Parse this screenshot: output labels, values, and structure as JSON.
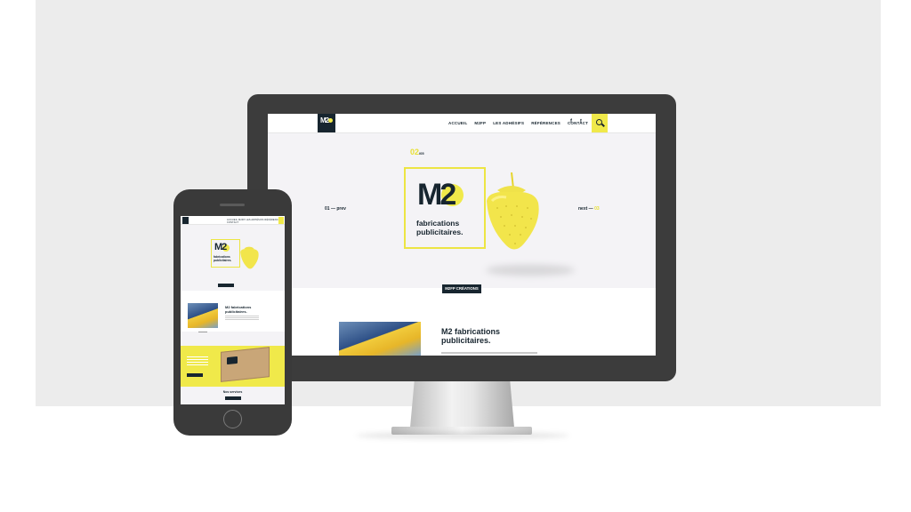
{
  "colors": {
    "accent": "#f0e94a",
    "navy": "#17252f",
    "light_bg": "#f4f3f6"
  },
  "desktop": {
    "nav": {
      "logo_text": "M2",
      "menu": [
        "ACCUEIL",
        "M2FP",
        "LES ADHÉSIFS",
        "RÉFÉRENCES",
        "CONTACT"
      ],
      "social": [
        "f",
        "t"
      ],
      "search_icon": "search-icon"
    },
    "hero": {
      "slide_current": "02",
      "slide_total": "/05",
      "prev_num": "01",
      "prev_label": "prev",
      "next_label": "next",
      "next_num": "03",
      "logo_text": "M2",
      "tagline_line1": "fabrications",
      "tagline_line2": "publicitaires."
    },
    "button": "M2FP CRÉATIONS",
    "section": {
      "title_line1": "M2 fabrications",
      "title_line2": "publicitaires."
    }
  },
  "phone": {
    "nav": {
      "menu": "ACCUEIL  M2FP  LES ADHÉSIFS  RÉFÉRENCES  CONTACT"
    },
    "hero": {
      "logo_text": "M2",
      "tagline_line1": "fabrications",
      "tagline_line2": "publicitaires."
    },
    "section": {
      "title_line1": "M2 fabrications",
      "title_line2": "publicitaires."
    },
    "services_title": "Nos services"
  }
}
